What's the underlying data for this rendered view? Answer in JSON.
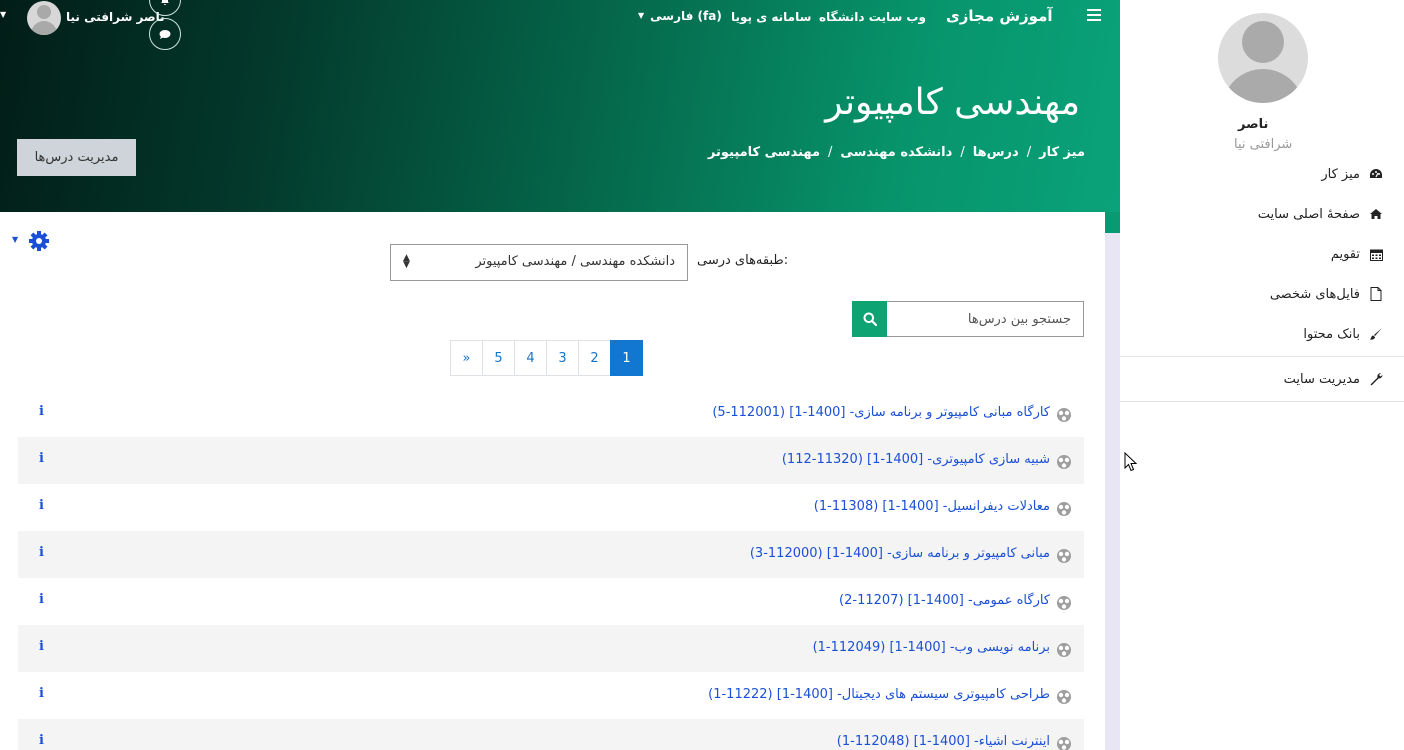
{
  "header": {
    "site_name": "آموزش مجازی",
    "nav_links": [
      "وب سایت دانشگاه",
      "سامانه ی پویا"
    ],
    "language": "فارسی (fa)",
    "user_name": "ناصر شرافتی نیا",
    "page_title": "مهندسی کامپیوتر",
    "breadcrumb": [
      "میز کار",
      "درس‌ها",
      "دانشکده مهندسی",
      "مهندسی کامپیوتر"
    ],
    "manage_courses_label": "مدیریت درس‌ها"
  },
  "filter": {
    "category_label": "طبقه‌های درسی:",
    "category_value": "دانشکده مهندسی / مهندسی کامپیوتر",
    "search_placeholder": "جستجو بین درس‌ها"
  },
  "pagination": {
    "pages": [
      "1",
      "2",
      "3",
      "4",
      "5"
    ],
    "next": "»",
    "current": "1"
  },
  "courses": [
    {
      "title": "کارگاه مبانی کامپیوتر و برنامه سازی- [1400-1] (112001-5)"
    },
    {
      "title": "شبیه سازی کامپیوتری- [1400-1] (11320-112)"
    },
    {
      "title": "معادلات دیفرانسیل- [1400-1] (11308-1)"
    },
    {
      "title": "مبانی کامپیوتر و برنامه سازی- [1400-1] (112000-3)"
    },
    {
      "title": "کارگاه عمومی- [1400-1] (11207-2)"
    },
    {
      "title": "برنامه نویسی وب- [1400-1] (112049-1)"
    },
    {
      "title": "طراحی کامپیوتری سیستم های دیجیتال- [1400-1] (11222-1)"
    },
    {
      "title": "اینترنت اشیاء- [1400-1] (112048-1)"
    }
  ],
  "course_info_glyph": "i",
  "sidebar": {
    "first_name": "ناصر",
    "last_name": "شرافتی نیا",
    "items": [
      {
        "label": "میز کار",
        "icon": "dashboard-icon"
      },
      {
        "label": "صفحهٔ اصلی سایت",
        "icon": "home-icon"
      },
      {
        "label": "تقویم",
        "icon": "calendar-icon"
      },
      {
        "label": "فایل‌های شخصی",
        "icon": "file-icon"
      },
      {
        "label": "بانک محتوا",
        "icon": "brush-icon"
      }
    ],
    "admin_item": {
      "label": "مدیریت سایت",
      "icon": "wrench-icon"
    }
  },
  "colors": {
    "brand_green": "#0ea373",
    "link_blue": "#1a4fd6",
    "active_page": "#1177d1"
  }
}
